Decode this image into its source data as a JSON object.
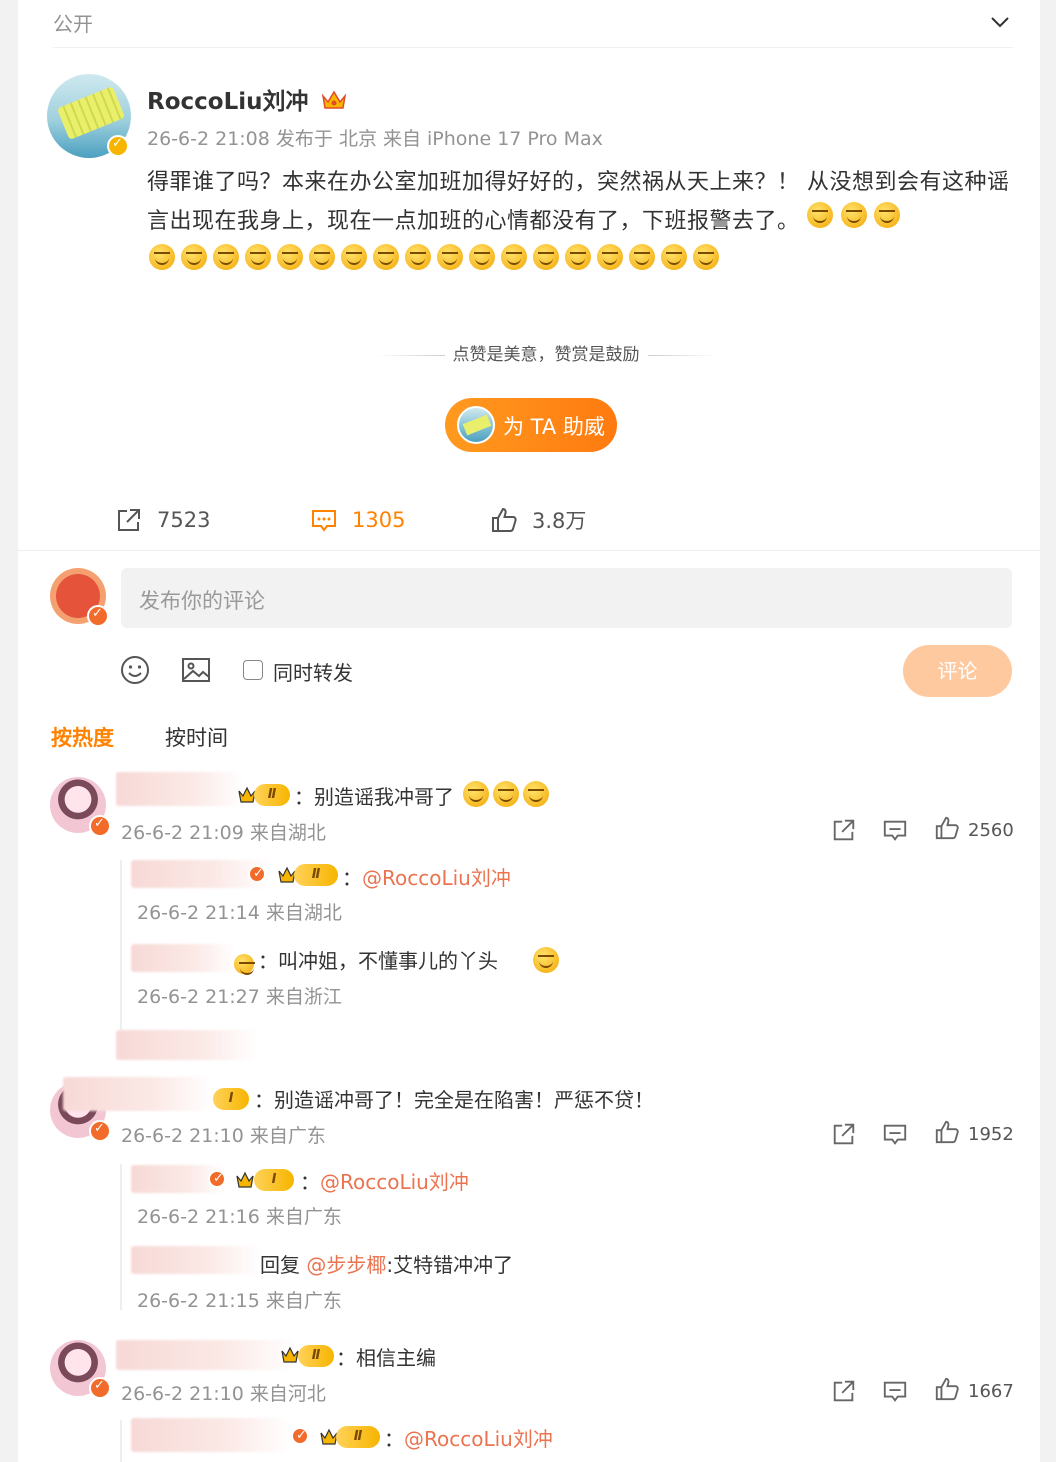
{
  "topbar": {
    "visibility": "公开"
  },
  "post": {
    "author": "RoccoLiu刘冲",
    "meta": "26-6-2 21:08  发布于 北京  来自 iPhone 17 Pro Max",
    "text": "得罪谁了吗？本来在办公室加班加得好好的，突然祸从天上来？！ 从没想到会有这种谣言出现在我身上，现在一点加班的心情都没有了，下班报警去了。",
    "emoji_name": "sweat-smile-emoji",
    "reward_tip": "点赞是美意，赞赏是鼓励",
    "reward_button": "为 TA 助威",
    "stats": {
      "reposts": "7523",
      "comments": "1305",
      "likes": "3.8万"
    }
  },
  "composer": {
    "placeholder": "发布你的评论",
    "repost_label": "同时转发",
    "submit_label": "评论"
  },
  "sort": {
    "hot": "按热度",
    "time": "按时间"
  },
  "comments": [
    {
      "text": "：别造谣我冲哥了",
      "meta": "26-6-2 21:09 来自湖北",
      "likes": "2560",
      "level": "Ⅱ",
      "replies": [
        {
          "prefix": "：",
          "mention": "@RoccoLiu刘冲",
          "text": "",
          "meta": "26-6-2 21:14 来自湖北",
          "level": "Ⅱ"
        },
        {
          "prefix": "：",
          "mention": "",
          "text": "叫冲姐，不懂事儿的丫头",
          "meta": "26-6-2 21:27 来自浙江",
          "level": ""
        }
      ]
    },
    {
      "text": "：别造谣冲哥了！完全是在陷害！严惩不贷！",
      "meta": "26-6-2 21:10 来自广东",
      "likes": "1952",
      "level": "Ⅰ",
      "replies": [
        {
          "prefix": "：",
          "mention": "@RoccoLiu刘冲",
          "text": "",
          "meta": "26-6-2 21:16 来自广东",
          "level": "Ⅰ"
        },
        {
          "prefix": "回复 ",
          "mention": "@步步椰",
          "text": ":艾特错冲冲了",
          "meta": "26-6-2 21:15 来自广东",
          "level": ""
        }
      ]
    },
    {
      "text": "：相信主编",
      "meta": "26-6-2 21:10 来自河北",
      "likes": "1667",
      "level": "Ⅱ",
      "replies": [
        {
          "prefix": "：",
          "mention": "@RoccoLiu刘冲",
          "text": "",
          "meta": "",
          "level": "Ⅱ"
        }
      ]
    }
  ],
  "colors": {
    "accent": "#ff8200",
    "mention": "#eb7350",
    "muted": "#939393"
  }
}
